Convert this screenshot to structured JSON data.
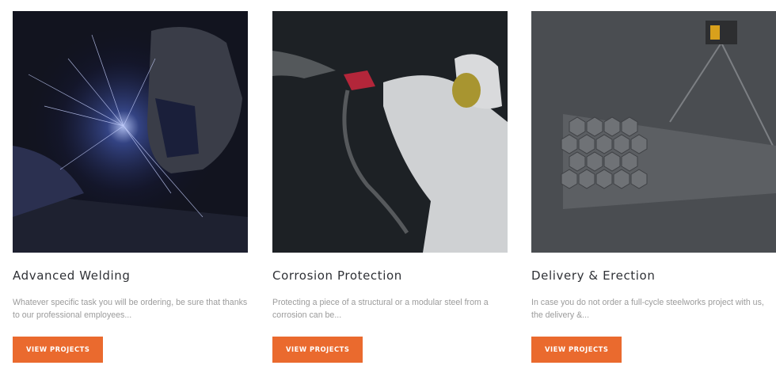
{
  "cards": [
    {
      "title": "Advanced Welding",
      "description": "Whatever specific task you will be ordering, be sure that thanks to our professional employees...",
      "button_label": "VIEW PROJECTS",
      "image": "welding-photo"
    },
    {
      "title": "Corrosion Protection",
      "description": "Protecting a piece of a structural or a modular steel from a corrosion can be...",
      "button_label": "VIEW PROJECTS",
      "image": "spray-painting-photo"
    },
    {
      "title": "Delivery & Erection",
      "description": "In case you do not order a full-cycle steelworks project with us, the delivery &...",
      "button_label": "VIEW PROJECTS",
      "image": "steel-beams-crane-photo"
    }
  ],
  "colors": {
    "button_bg": "#ea6a2e",
    "button_text": "#ffffff",
    "title_text": "#2f3136",
    "description_text": "#9b9b9b"
  }
}
